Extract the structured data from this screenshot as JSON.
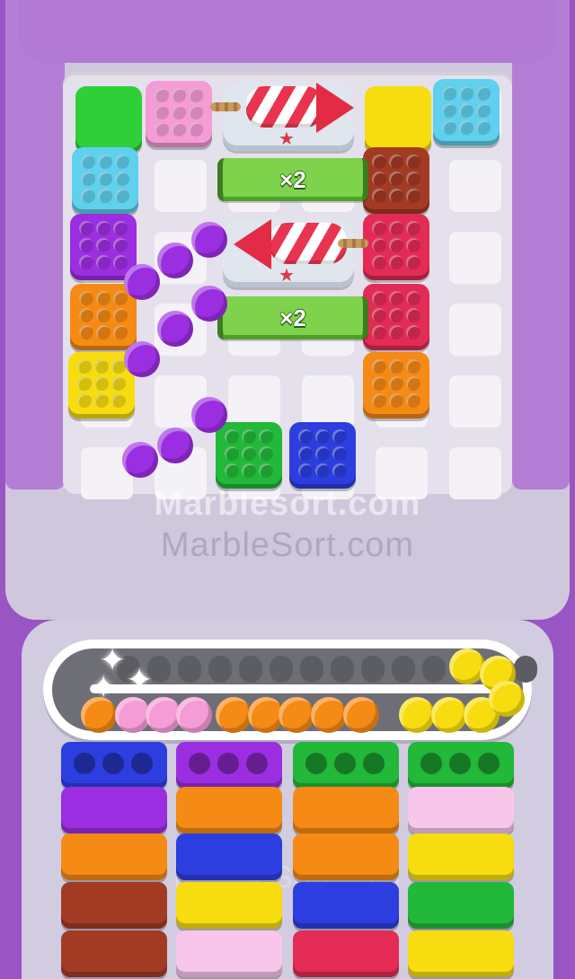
{
  "watermark": {
    "line1": "Marblesort.com",
    "line2": "MarbleSort.com",
    "line3": "MarbleSort.com"
  },
  "multipliers": [
    {
      "label": "×2"
    },
    {
      "label": "×2"
    }
  ],
  "colors": {
    "green": "#2fcf3a",
    "pink": "#f59bd6",
    "cyan": "#5fd0ee",
    "yellow": "#f7dd10",
    "purple": "#9b2ee0",
    "orange": "#f58a14",
    "brown": "#a33a24",
    "red": "#e32b55",
    "blue": "#2d3ee0",
    "dark_green": "#22b83a",
    "light_pink": "#f8c6ea"
  },
  "board_blocks": [
    {
      "color": "green",
      "style": "plain"
    },
    {
      "color": "pink",
      "style": "dotted"
    },
    {
      "color": "yellow",
      "style": "plain"
    },
    {
      "color": "cyan",
      "style": "dotted"
    },
    {
      "color": "cyan",
      "style": "dotted"
    },
    {
      "color": "brown",
      "style": "dotted"
    },
    {
      "color": "purple",
      "style": "dotted"
    },
    {
      "color": "red",
      "style": "dotted"
    },
    {
      "color": "orange",
      "style": "dotted"
    },
    {
      "color": "red",
      "style": "dotted"
    },
    {
      "color": "yellow",
      "style": "dotted"
    },
    {
      "color": "orange",
      "style": "dotted"
    },
    {
      "color": "dark_green",
      "style": "dotted"
    },
    {
      "color": "blue",
      "style": "dotted"
    }
  ],
  "rockets": [
    {
      "direction": "right"
    },
    {
      "direction": "left"
    }
  ],
  "falling_marbles": {
    "color": "purple",
    "count": 9
  },
  "conveyor": {
    "bottom_lane": [
      "orange",
      "pink",
      "pink",
      "pink",
      "orange",
      "orange",
      "orange",
      "orange",
      "orange",
      "yellow",
      "yellow",
      "yellow"
    ],
    "right_end": [
      "yellow",
      "yellow",
      "yellow"
    ]
  },
  "bins": [
    [
      "blue",
      "purple",
      "orange",
      "brown",
      "brown"
    ],
    [
      "purple",
      "orange",
      "blue",
      "yellow",
      "light_pink"
    ],
    [
      "dark_green",
      "orange",
      "orange",
      "blue",
      "red"
    ],
    [
      "dark_green",
      "light_pink",
      "yellow",
      "dark_green",
      "yellow"
    ]
  ],
  "icons": [
    "sparkle-icon",
    "star-icon",
    "rocket-icon"
  ]
}
